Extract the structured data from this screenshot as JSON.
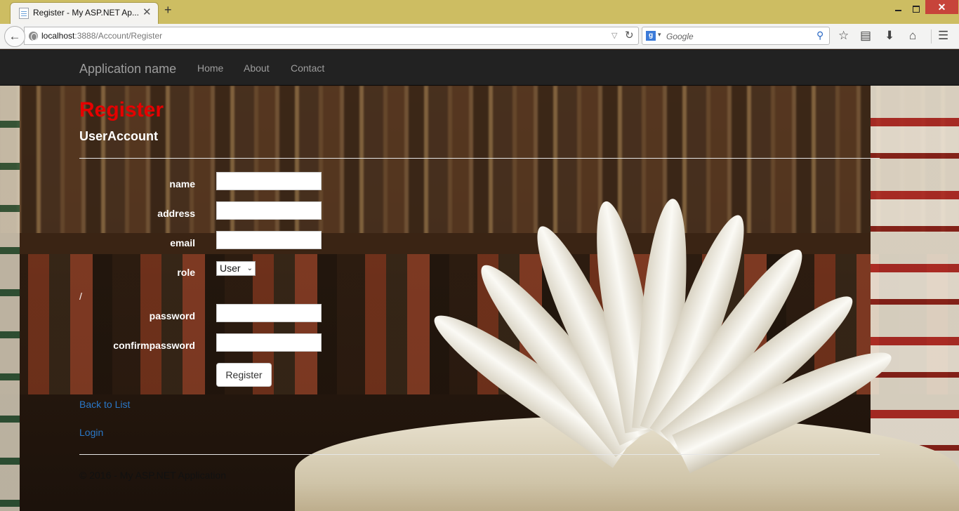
{
  "browser": {
    "tab_title": "Register - My ASP.NET Ap...",
    "tab_close": "✕",
    "new_tab": "+",
    "url_host": "localhost",
    "url_path": ":3888/Account/Register",
    "search_placeholder": "Google",
    "search_engine_glyph": "g",
    "window_close": "✕"
  },
  "nav": {
    "brand": "Application name",
    "links": [
      "Home",
      "About",
      "Contact"
    ]
  },
  "page": {
    "title": "Register",
    "subtitle": "UserAccount",
    "title_color": "#e50000"
  },
  "form": {
    "name_label": "name",
    "address_label": "address",
    "email_label": "email",
    "role_label": "role",
    "role_value": "User",
    "stray_text": "/",
    "password_label": "password",
    "confirm_label": "confirmpassword",
    "submit_label": "Register"
  },
  "links": {
    "back": "Back to List",
    "login": "Login"
  },
  "footer": {
    "text": "© 2016 - My ASP.NET Application"
  }
}
